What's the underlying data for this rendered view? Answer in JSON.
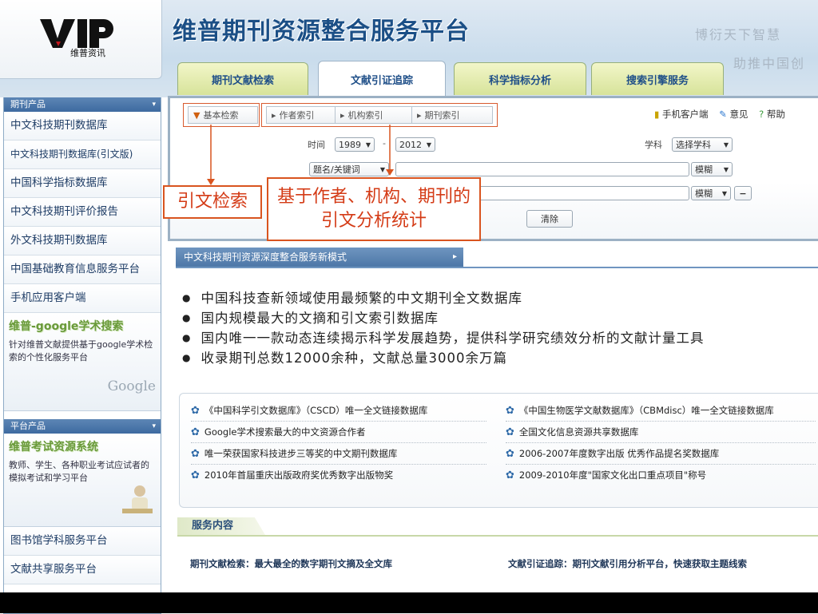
{
  "header": {
    "logo_text": "维普资讯",
    "site_title": "维普期刊资源整合服务平台",
    "slogan_line1": "博衍天下智慧",
    "slogan_line2": "助推中国创",
    "tabs": [
      {
        "label": "期刊文献检索"
      },
      {
        "label": "文献引证追踪"
      },
      {
        "label": "科学指标分析"
      },
      {
        "label": "搜索引擎服务"
      }
    ]
  },
  "sidebar": {
    "section1_title": "期刊产品",
    "items": [
      "中文科技期刊数据库",
      "中文科技期刊数据库(引文版)",
      "中国科学指标数据库",
      "中文科技期刊评价报告",
      "外文科技期刊数据库",
      "中国基础教育信息服务平台",
      "手机应用客户端"
    ],
    "google_title": "维普-google学术搜索",
    "google_desc": "针对维普文献提供基于google学术检索的个性化服务平台",
    "google_logo": "Google",
    "section2_title": "平台产品",
    "exam_title": "维普考试资源系统",
    "exam_desc": "教师、学生、各种职业考试应试者的模拟考试和学习平台",
    "items2": [
      "图书馆学科服务平台",
      "文献共享服务平台"
    ]
  },
  "search": {
    "subtabs": [
      "基本检索",
      "作者索引",
      "机构索引",
      "期刊索引"
    ],
    "links": {
      "mobile": "手机客户端",
      "feedback": "意见",
      "help": "帮助"
    },
    "time_label": "时间",
    "year_from": "1989",
    "year_to": "2012",
    "subject_label": "学科",
    "subject_value": "选择学科",
    "field_select": "题名/关键词",
    "match1": "模糊",
    "match2": "模糊",
    "clear_label": "清除",
    "callout_citation": "引文检索",
    "callout_analysis": "基于作者、机构、期刊的引文分析统计"
  },
  "intro": {
    "bar_title": "中文科技期刊资源深度整合服务新模式",
    "bullets": [
      "中国科技查新领域使用最频繁的中文期刊全文数据库",
      "国内规模最大的文摘和引文索引数据库",
      "国内唯一一款动态连续揭示科学发展趋势，提供科学研究绩效分析的文献计量工具",
      "收录期刊总数12000余种，文献总量3000余万篇"
    ]
  },
  "awards": {
    "left": [
      "《中国科学引文数据库》（CSCD）唯一全文链接数据库",
      "Google学术搜索最大的中文资源合作者",
      "唯一荣获国家科技进步三等奖的中文期刊数据库",
      "2010年首届重庆出版政府奖优秀数字出版物奖"
    ],
    "right": [
      "《中国生物医学文献数据库》（CBMdisc）唯一全文链接数据库",
      "全国文化信息资源共享数据库",
      "2006-2007年度数字出版 优秀作品提名奖数据库",
      "2009-2010年度\"国家文化出口重点项目\"称号"
    ]
  },
  "service": {
    "title": "服务内容",
    "item1": "期刊文献检索：最大最全的数字期刊文摘及全文库",
    "item2": "文献引证追踪：期刊文献引用分析平台，快速获取主题线索"
  },
  "colors": {
    "accent": "#1b4f86",
    "callout": "#d9541f",
    "tab_bg": "#e6eeb3"
  }
}
